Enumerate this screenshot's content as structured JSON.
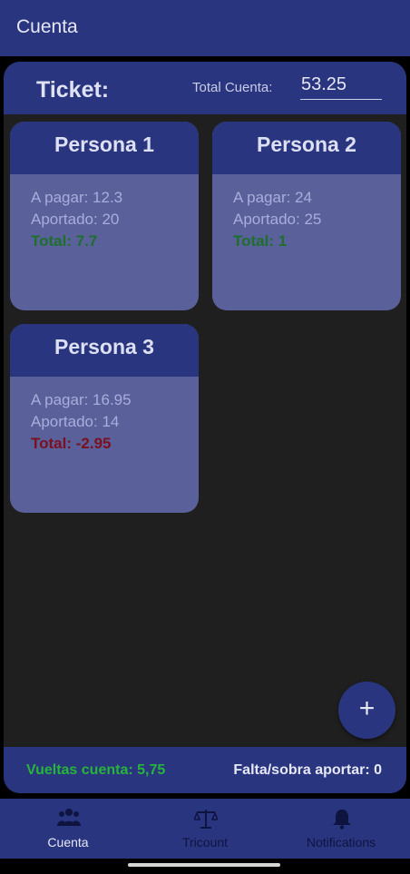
{
  "appbar": {
    "title": "Cuenta"
  },
  "ticket": {
    "label": "Ticket:",
    "total_label": "Total Cuenta:",
    "total_value": "53.25"
  },
  "cards": [
    {
      "name": "Persona 1",
      "pagar": "A pagar: 12.3",
      "aportado": "Aportado: 20",
      "total": "Total: 7.7",
      "status": "positive"
    },
    {
      "name": "Persona 2",
      "pagar": "A pagar: 24",
      "aportado": "Aportado: 25",
      "total": "Total: 1",
      "status": "positive"
    },
    {
      "name": "Persona 3",
      "pagar": "A pagar: 16.95",
      "aportado": "Aportado: 14",
      "total": "Total: -2.95",
      "status": "negative"
    }
  ],
  "fab": {
    "icon": "plus-icon",
    "label": "+"
  },
  "footer": {
    "vueltas": "Vueltas cuenta: 5,75",
    "falta": "Falta/sobra aportar: 0"
  },
  "nav": [
    {
      "label": "Cuenta",
      "icon": "people-icon",
      "active": true
    },
    {
      "label": "Tricount",
      "icon": "scale-icon",
      "active": false
    },
    {
      "label": "Notifications",
      "icon": "bell-icon",
      "active": false
    }
  ],
  "colors": {
    "primary": "#2a3580",
    "card": "#5a609a",
    "background": "#1f1f1f",
    "positive": "#1e6e2e",
    "negative": "#7a1020",
    "vueltas": "#27b43a"
  }
}
